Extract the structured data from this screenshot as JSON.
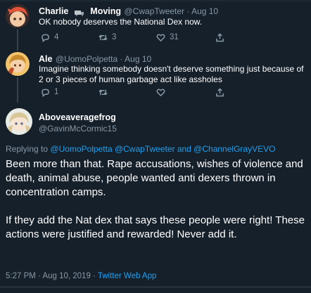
{
  "thread": [
    {
      "name": "Charlie",
      "name_suffix": "Moving",
      "handle": "@CwapTweeter",
      "time": "Aug 10",
      "text": "OK nobody deserves the National Dex now.",
      "replies": "4",
      "retweets": "3",
      "likes": "31"
    },
    {
      "name": "Ale",
      "handle": "@UomoPolpetta",
      "time": "Aug 10",
      "text": "Imagine thinking somebody doesn't deserve something just because of 2 or 3 pieces of human garbage act like assholes",
      "replies": "1",
      "retweets": "",
      "likes": ""
    }
  ],
  "main": {
    "name": "Aboveaveragefrog",
    "handle": "@GavinMcCormic15",
    "replying_prefix": "Replying to",
    "replying_links": "@UomoPolpetta @CwapTweeter and @ChannelGrayVEVO",
    "paragraph1": "Been more than that. Rape accusations, wishes of violence and death, animal abuse, people wanted anti dexers thrown in concentration camps.",
    "paragraph2": "If they add the Nat dex that says these people were right! These actions were justified and rewarded! Never add it.",
    "timestamp": "5:27 PM · Aug 10, 2019 ·",
    "source": "Twitter Web App"
  },
  "sep": " · ",
  "icons": [
    "reply-icon",
    "retweet-icon",
    "like-icon",
    "share-icon"
  ],
  "colors": {
    "background": "#15202b",
    "secondary": "#8899a6",
    "link": "#1da1f2",
    "border": "#38444d"
  }
}
